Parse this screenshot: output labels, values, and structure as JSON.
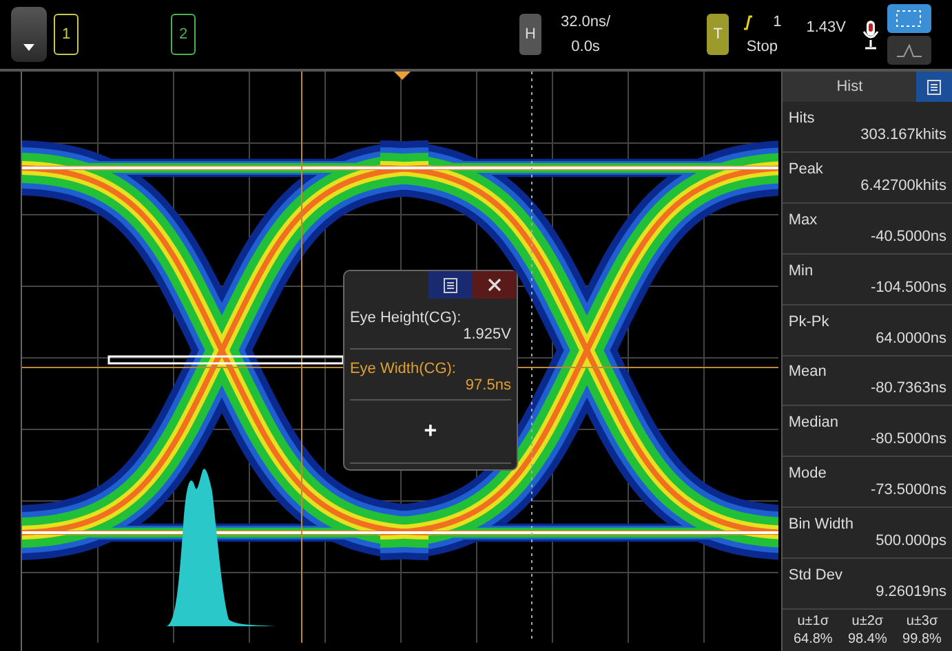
{
  "channels": [
    {
      "label": "1",
      "color": "#c9c84c"
    },
    {
      "label": "2",
      "color": "#4db04d"
    }
  ],
  "horizontal": {
    "key": "H",
    "scale": "32.0ns/",
    "delay": "0.0s"
  },
  "trigger": {
    "key": "T",
    "source": "1",
    "level": "1.43V",
    "status": "Stop"
  },
  "hist_panel": {
    "title": "Hist",
    "stats": [
      {
        "label": "Hits",
        "value": "303.167khits"
      },
      {
        "label": "Peak",
        "value": "6.42700khits"
      },
      {
        "label": "Max",
        "value": "-40.5000ns"
      },
      {
        "label": "Min",
        "value": "-104.500ns"
      },
      {
        "label": "Pk-Pk",
        "value": "64.0000ns"
      },
      {
        "label": "Mean",
        "value": "-80.7363ns"
      },
      {
        "label": "Median",
        "value": "-80.5000ns"
      },
      {
        "label": "Mode",
        "value": "-73.5000ns"
      },
      {
        "label": "Bin Width",
        "value": "500.000ps"
      },
      {
        "label": "Std Dev",
        "value": "9.26019ns"
      }
    ],
    "sigma": [
      {
        "label": "u±1σ",
        "value": "64.8%"
      },
      {
        "label": "u±2σ",
        "value": "98.4%"
      },
      {
        "label": "u±3σ",
        "value": "99.8%"
      }
    ]
  },
  "measurements": {
    "items": [
      {
        "label": "Eye Height(CG):",
        "value": "1.925V",
        "selected": false
      },
      {
        "label": "Eye Width(CG):",
        "value": "97.5ns",
        "selected": true
      }
    ],
    "add": "+"
  }
}
